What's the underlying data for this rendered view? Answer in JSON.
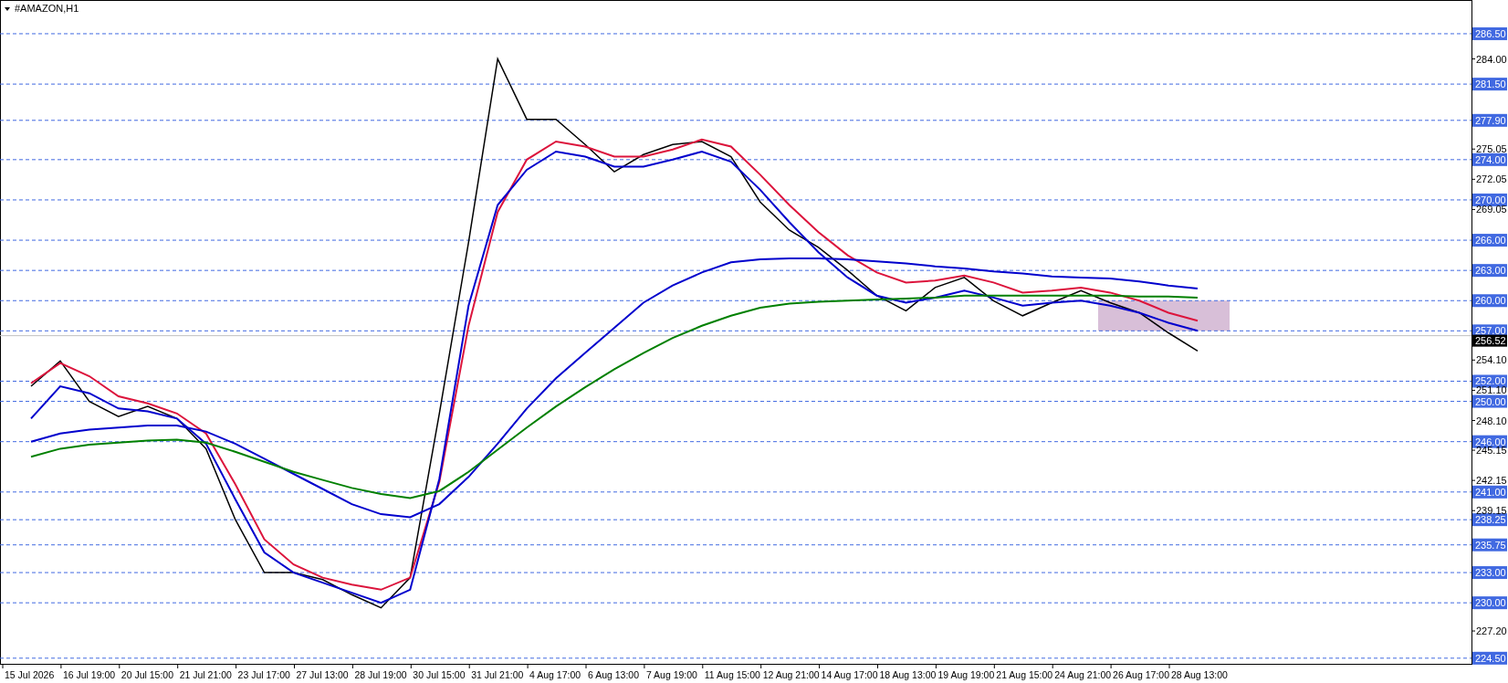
{
  "title": "#AMAZON,H1",
  "chart": {
    "chart_data": {
      "type": "line",
      "categories": [
        "15 Jul 2026",
        null,
        "16 Jul 19:00",
        null,
        "20 Jul 15:00",
        null,
        "21 Jul 21:00",
        null,
        "23 Jul 17:00",
        null,
        "27 Jul 13:00",
        null,
        "28 Jul 19:00",
        null,
        "30 Jul 15:00",
        null,
        "31 Jul 21:00",
        null,
        "4 Aug 17:00",
        null,
        "6 Aug 13:00",
        null,
        "7 Aug 19:00",
        null,
        "11 Aug 15:00",
        null,
        "12 Aug 21:00",
        null,
        "14 Aug 17:00",
        null,
        "18 Aug 13:00",
        null,
        "19 Aug 19:00",
        null,
        "21 Aug 15:00",
        null,
        "24 Aug 21:00",
        null,
        "26 Aug 17:00",
        null,
        "28 Aug 13:00"
      ],
      "series": [
        {
          "color": "#000000",
          "values": [
            251.5,
            254,
            250,
            248.5,
            249.5,
            248.3,
            245.3,
            238.3,
            233,
            233,
            232.3,
            230.8,
            229.5,
            232.5,
            248.8,
            265.8,
            284,
            278,
            278,
            275.5,
            272.8,
            274.5,
            275.5,
            275.8,
            274.3,
            269.8,
            267,
            265.3,
            263,
            260.5,
            259,
            261.3,
            262.3,
            260,
            258.5,
            259.8,
            261,
            259.8,
            258.8,
            256.8,
            255
          ]
        },
        {
          "color": "#dc143c",
          "values": [
            251.8,
            253.8,
            252.5,
            250.5,
            249.8,
            248.8,
            246.8,
            241.8,
            236.3,
            233.8,
            232.5,
            231.8,
            231.3,
            232.5,
            242,
            257.5,
            268.8,
            274,
            275.8,
            275.3,
            274.3,
            274.3,
            275,
            276,
            275.3,
            272.5,
            269.5,
            266.8,
            264.5,
            262.8,
            261.8,
            262,
            262.5,
            261.8,
            260.8,
            261,
            261.3,
            260.8,
            260,
            258.8,
            258
          ]
        },
        {
          "color": "#0000cd",
          "values": [
            248.3,
            251.5,
            250.8,
            249.3,
            249,
            248.3,
            245.8,
            240.3,
            235,
            233,
            232,
            231,
            230,
            231.3,
            242.3,
            259.5,
            269.5,
            273,
            274.8,
            274.3,
            273.3,
            273.3,
            274,
            274.8,
            273.8,
            271,
            267.8,
            264.8,
            262.3,
            260.5,
            259.8,
            260.3,
            261,
            260.3,
            259.5,
            259.8,
            260,
            259.5,
            258.8,
            257.8,
            257
          ]
        },
        {
          "color": "#0000cd",
          "values": [
            246,
            246.8,
            247.2,
            247.4,
            247.6,
            247.6,
            247,
            245.8,
            244.3,
            242.8,
            241.3,
            239.8,
            238.8,
            238.5,
            239.8,
            242.5,
            245.8,
            249.3,
            252.3,
            254.8,
            257.3,
            259.8,
            261.5,
            262.8,
            263.8,
            264.1,
            264.2,
            264.2,
            264.1,
            263.9,
            263.7,
            263.4,
            263.2,
            262.9,
            262.7,
            262.4,
            262.3,
            262.2,
            261.9,
            261.5,
            261.2
          ]
        },
        {
          "color": "#008000",
          "values": [
            244.5,
            245.3,
            245.7,
            245.9,
            246.1,
            246.2,
            245.9,
            245,
            244,
            243,
            242.2,
            241.4,
            240.8,
            240.4,
            241.1,
            243,
            245.2,
            247.4,
            249.5,
            251.4,
            253.2,
            254.8,
            256.3,
            257.5,
            258.5,
            259.3,
            259.7,
            259.9,
            260,
            260.1,
            260.2,
            260.3,
            260.5,
            260.5,
            260.5,
            260.5,
            260.5,
            260.5,
            260.4,
            260.4,
            260.3
          ]
        }
      ],
      "ylim": [
        223.94,
        289.85
      ],
      "yticks": [
        {
          "value": 284,
          "label": "284.00"
        },
        {
          "value": 275.05,
          "label": "275.05"
        },
        {
          "value": 272.05,
          "label": "272.05"
        },
        {
          "value": 269.05,
          "label": "269.05"
        },
        {
          "value": 254.1,
          "label": "254.10"
        },
        {
          "value": 251.1,
          "label": "251.10"
        },
        {
          "value": 248.1,
          "label": "248.10"
        },
        {
          "value": 245.15,
          "label": "245.15"
        },
        {
          "value": 242.15,
          "label": "242.15"
        },
        {
          "value": 239.15,
          "label": "239.15"
        },
        {
          "value": 227.2,
          "label": "227.20"
        }
      ],
      "bands": [
        {
          "axis": "y",
          "from": 257,
          "to": 260,
          "color": "#d8bfd8"
        }
      ],
      "ref_lines": [
        {
          "axis": "y",
          "value": 256.52,
          "label": "256.52",
          "color": "#c0c0c0"
        },
        {
          "axis": "y",
          "value": 286.5,
          "label": "286.50",
          "color": "#4169e1"
        },
        {
          "axis": "y",
          "value": 281.5,
          "label": "281.50",
          "color": "#4169e1"
        },
        {
          "axis": "y",
          "value": 277.9,
          "label": "277.90",
          "color": "#4169e1"
        },
        {
          "axis": "y",
          "value": 274,
          "label": "274.00",
          "color": "#4169e1"
        },
        {
          "axis": "y",
          "value": 270,
          "label": "270.00",
          "color": "#4169e1"
        },
        {
          "axis": "y",
          "value": 266,
          "label": "266.00",
          "color": "#4169e1"
        },
        {
          "axis": "y",
          "value": 263,
          "label": "263.00",
          "color": "#4169e1"
        },
        {
          "axis": "y",
          "value": 260,
          "label": "260.00",
          "color": "#4169e1"
        },
        {
          "axis": "y",
          "value": 257,
          "label": "257.00",
          "color": "#4169e1"
        },
        {
          "axis": "y",
          "value": 252,
          "label": "252.00",
          "color": "#4169e1"
        },
        {
          "axis": "y",
          "value": 250,
          "label": "250.00",
          "color": "#4169e1"
        },
        {
          "axis": "y",
          "value": 246,
          "label": "246.00",
          "color": "#4169e1"
        },
        {
          "axis": "y",
          "value": 241,
          "label": "241.00",
          "color": "#4169e1"
        },
        {
          "axis": "y",
          "value": 238.25,
          "label": "238.25",
          "color": "#4169e1"
        },
        {
          "axis": "y",
          "value": 235.75,
          "label": "235.75",
          "color": "#4169e1"
        },
        {
          "axis": "y",
          "value": 233,
          "label": "233.00",
          "color": "#4169e1"
        },
        {
          "axis": "y",
          "value": 230,
          "label": "230.00",
          "color": "#4169e1"
        },
        {
          "axis": "y",
          "value": 224.5,
          "label": "224.50",
          "color": "#4169e1"
        }
      ]
    }
  }
}
